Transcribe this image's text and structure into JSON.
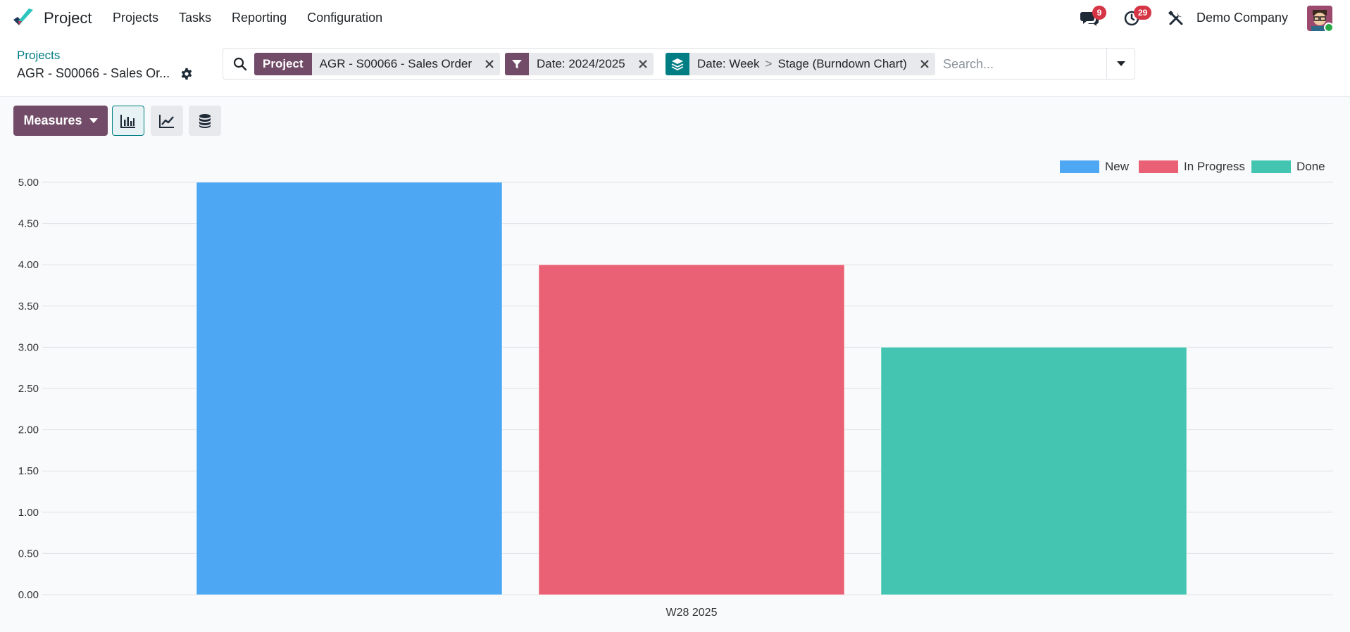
{
  "app": {
    "name": "Project",
    "menu": [
      "Projects",
      "Tasks",
      "Reporting",
      "Configuration"
    ],
    "messages_count": "9",
    "activities_count": "29",
    "company": "Demo Company"
  },
  "breadcrumb": {
    "parent": "Projects",
    "current": "AGR - S00066 - Sales Or..."
  },
  "search": {
    "facets": [
      {
        "label": "Project",
        "value": "AGR - S00066 - Sales Order"
      },
      {
        "label": "filter-icon",
        "value": "Date: 2024/2025"
      },
      {
        "label": "layers-icon",
        "values": [
          "Date: Week",
          "Stage (Burndown Chart)"
        ],
        "separator": ">"
      }
    ],
    "placeholder": "Search..."
  },
  "toolbar": {
    "measures_label": "Measures",
    "views": [
      "bar-chart",
      "line-chart",
      "pie-chart"
    ],
    "active_view": "bar-chart"
  },
  "colors": {
    "primary": "#714b67",
    "accent": "#017e84",
    "new": "#4ea7f2",
    "in_progress": "#ea6175",
    "done": "#43c5b1"
  },
  "chart_data": {
    "type": "bar",
    "categories": [
      "W28 2025"
    ],
    "series": [
      {
        "name": "New",
        "values": [
          5
        ],
        "color": "#4ea7f2"
      },
      {
        "name": "In Progress",
        "values": [
          4
        ],
        "color": "#ea6175"
      },
      {
        "name": "Done",
        "values": [
          3
        ],
        "color": "#43c5b1"
      }
    ],
    "yticks": [
      "0.00",
      "0.50",
      "1.00",
      "1.50",
      "2.00",
      "2.50",
      "3.00",
      "3.50",
      "4.00",
      "4.50",
      "5.00"
    ],
    "ylim": [
      0,
      5
    ],
    "grid": true,
    "legend": "top-right"
  }
}
